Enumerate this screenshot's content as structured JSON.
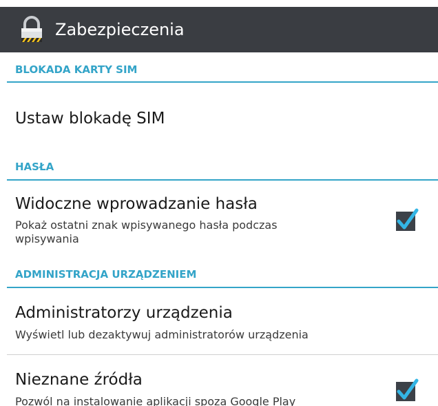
{
  "header": {
    "title": "Zabezpieczenia",
    "icon": "lock-icon"
  },
  "sections": {
    "sim": {
      "title": "BLOKADA KARTY SIM",
      "items": [
        {
          "title": "Ustaw blokadę SIM"
        }
      ]
    },
    "passwords": {
      "title": "HASŁA",
      "items": [
        {
          "title": "Widoczne wprowadzanie hasła",
          "summary": "Pokaż ostatni znak wpisywanego hasła podczas wpisywania",
          "checked": true
        }
      ]
    },
    "device_admin": {
      "title": "ADMINISTRACJA URZĄDZENIEM",
      "items": [
        {
          "title": "Administratorzy urządzenia",
          "summary": "Wyświetl lub dezaktywuj administratorów urządzenia"
        },
        {
          "title": "Nieznane źródła",
          "summary": "Pozwól na instalowanie aplikacji spoza Google Play",
          "checked": true
        }
      ]
    }
  },
  "colors": {
    "action_bar": "#3a3d42",
    "accent": "#33a4c8",
    "checkbox_bg": "#3c4148",
    "check_mark": "#33b5e5"
  }
}
